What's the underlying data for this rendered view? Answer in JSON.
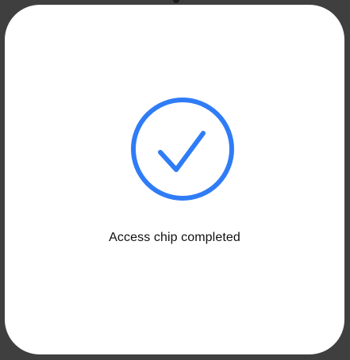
{
  "dialog": {
    "message": "Access chip completed",
    "icon": "checkmark-circle-icon",
    "accent_color": "#2f7cf6",
    "background_color": "#ffffff"
  },
  "backdrop": {
    "color": "#3f3f3f"
  }
}
